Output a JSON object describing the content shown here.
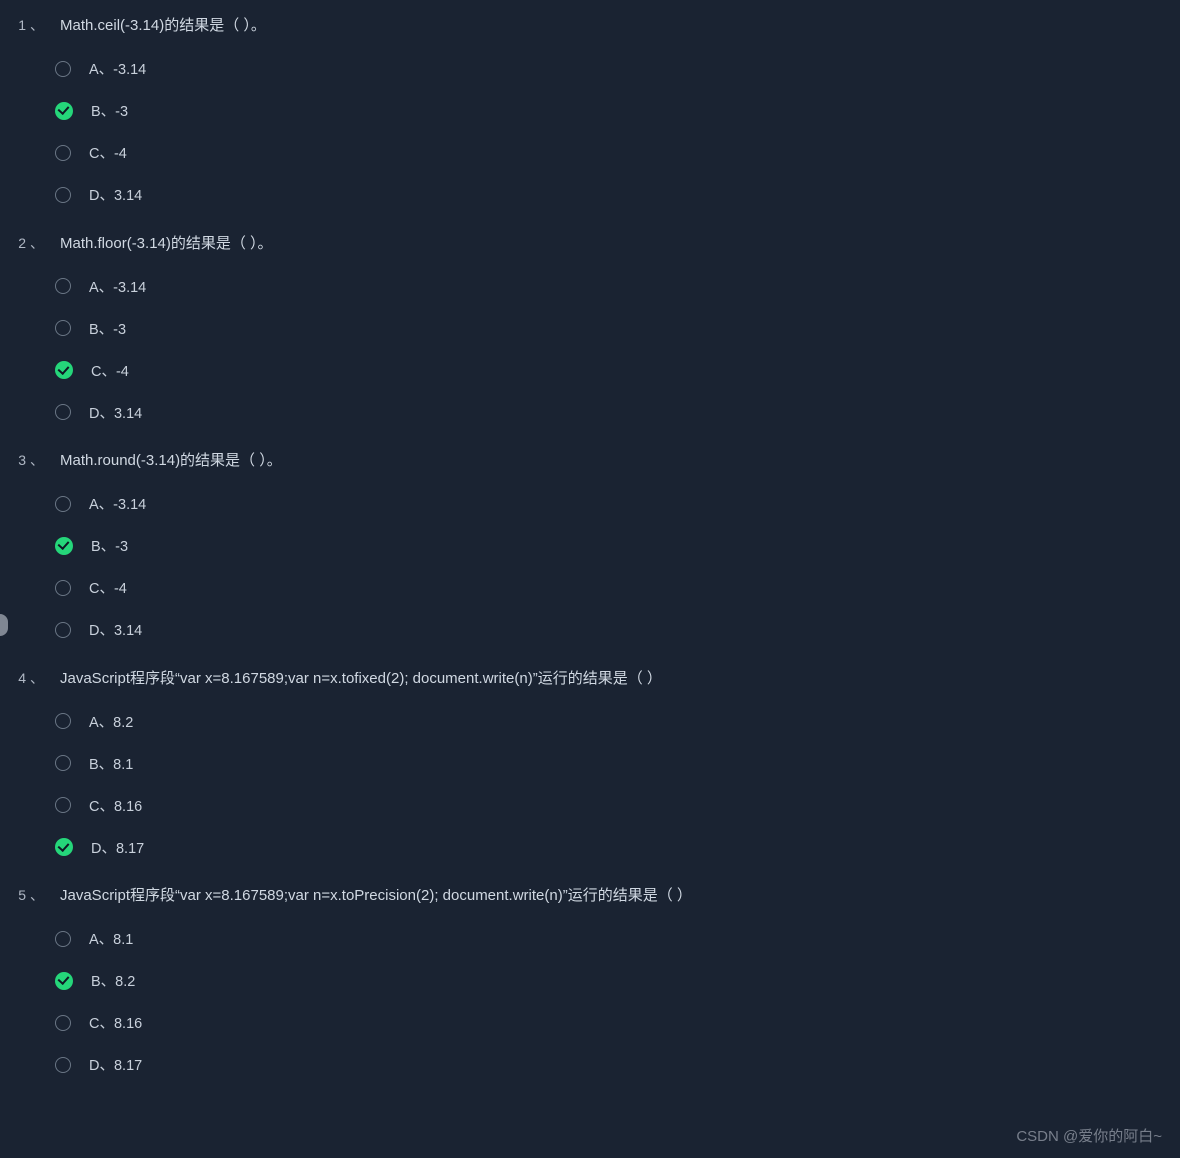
{
  "questions": [
    {
      "num": "1",
      "sep": "、",
      "text": "Math.ceil(-3.14)的结果是（   ）。",
      "options": [
        {
          "label": "A、-3.14",
          "correct": false
        },
        {
          "label": "B、-3",
          "correct": true
        },
        {
          "label": "C、-4",
          "correct": false
        },
        {
          "label": "D、3.14",
          "correct": false
        }
      ]
    },
    {
      "num": "2",
      "sep": "、",
      "text": "Math.floor(-3.14)的结果是（   ）。",
      "options": [
        {
          "label": "A、-3.14",
          "correct": false
        },
        {
          "label": "B、-3",
          "correct": false
        },
        {
          "label": "C、-4",
          "correct": true
        },
        {
          "label": "D、3.14",
          "correct": false
        }
      ]
    },
    {
      "num": "3",
      "sep": "、",
      "text": "Math.round(-3.14)的结果是（   ）。",
      "options": [
        {
          "label": "A、-3.14",
          "correct": false
        },
        {
          "label": "B、-3",
          "correct": true
        },
        {
          "label": "C、-4",
          "correct": false
        },
        {
          "label": "D、3.14",
          "correct": false
        }
      ]
    },
    {
      "num": "4",
      "sep": "、",
      "text": "JavaScript程序段“var x=8.167589;var n=x.tofixed(2); document.write(n)”运行的结果是（   ）",
      "options": [
        {
          "label": "A、8.2",
          "correct": false
        },
        {
          "label": "B、8.1",
          "correct": false
        },
        {
          "label": "C、8.16",
          "correct": false
        },
        {
          "label": "D、8.17",
          "correct": true
        }
      ]
    },
    {
      "num": "5",
      "sep": "、",
      "text": "JavaScript程序段“var x=8.167589;var n=x.toPrecision(2); document.write(n)”运行的结果是（   ）",
      "options": [
        {
          "label": "A、8.1",
          "correct": false
        },
        {
          "label": "B、8.2",
          "correct": true
        },
        {
          "label": "C、8.16",
          "correct": false
        },
        {
          "label": "D、8.17",
          "correct": false
        }
      ]
    }
  ],
  "watermark": "CSDN @爱你的阿白~"
}
